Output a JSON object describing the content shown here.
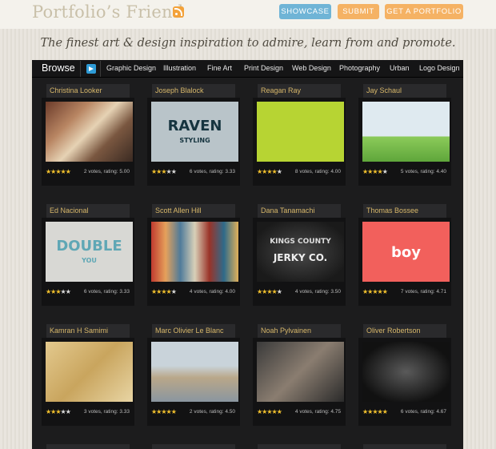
{
  "header": {
    "logo": "Portfolio’s Friend",
    "rss_icon": "rss-icon",
    "buttons": [
      "SHOWCASE",
      "SUBMIT",
      "GET A PORTFOLIO"
    ],
    "tagline": "The finest art & design inspiration to admire, learn from and promote."
  },
  "nav": {
    "browse": "Browse",
    "arrow_icon": "arrow-right-icon",
    "categories": [
      "Graphic Design",
      "Illustration",
      "Fine Art",
      "Print Design",
      "Web Design",
      "Photography",
      "Urban",
      "Logo Design"
    ]
  },
  "cards": [
    {
      "name": "Christina Looker",
      "votes": "2 votes, rating: 5.00",
      "rating": 5
    },
    {
      "name": "Joseph Blalock",
      "votes": "6 votes, rating: 3.33",
      "rating": 3,
      "thumb_text": "RAVEN",
      "thumb_sub": "STYLING"
    },
    {
      "name": "Reagan Ray",
      "votes": "8 votes, rating: 4.00",
      "rating": 4
    },
    {
      "name": "Jay Schaul",
      "votes": "5 votes, rating: 4.40",
      "rating": 4
    },
    {
      "name": "Ed Nacional",
      "votes": "6 votes, rating: 3.33",
      "rating": 3,
      "thumb_text": "DOUBLE",
      "thumb_sub": "YOU"
    },
    {
      "name": "Scott Allen Hill",
      "votes": "4 votes, rating: 4.00",
      "rating": 4
    },
    {
      "name": "Dana Tanamachi",
      "votes": "4 votes, rating: 3.50",
      "rating": 4,
      "thumb_text": "KINGS COUNTY",
      "thumb_sub": "JERKY CO."
    },
    {
      "name": "Thomas Bossee",
      "votes": "7 votes, rating: 4.71",
      "rating": 5,
      "thumb_text": "boy"
    },
    {
      "name": "Kamran H Samimi",
      "votes": "3 votes, rating: 3.33",
      "rating": 3
    },
    {
      "name": "Marc Olivier Le Blanc",
      "votes": "2 votes, rating: 4.50",
      "rating": 5
    },
    {
      "name": "Noah Pylvainen",
      "votes": "4 votes, rating: 4.75",
      "rating": 5
    },
    {
      "name": "Oliver Robertson",
      "votes": "6 votes, rating: 4.67",
      "rating": 5
    }
  ],
  "colors": {
    "panel": "#1c1c1d",
    "name_text": "#d7b76a",
    "showcase": "#6fb4d6",
    "orange_btn": "#f5b264",
    "star": "#f2c12e"
  }
}
